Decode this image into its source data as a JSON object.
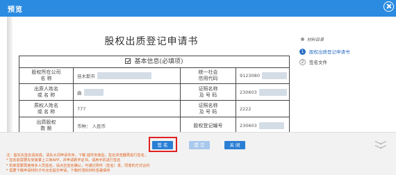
{
  "window": {
    "title": "预览"
  },
  "document": {
    "title": "股权出质登记申请书",
    "section_header": "基本信息(必填项)",
    "rows": [
      {
        "label1": "股权所在公司",
        "label1b": "名  称",
        "value1": "佳木斯市",
        "label2": "统一社会",
        "label2b": "信用代码",
        "value2": "9123080"
      },
      {
        "label1": "出质人姓名",
        "label1b": "或 名 称",
        "value1": "曲",
        "label2": "证照名称",
        "label2b": "及 号 码",
        "value2": "230603"
      },
      {
        "label1": "质权人姓名",
        "label1b": "或 名 称",
        "value1": "777",
        "label2": "证照名称",
        "label2b": "及 号 码",
        "value2": "2222"
      },
      {
        "label1": "出质股权",
        "label1b": "数  额",
        "value1": "币种： 人民币",
        "label2": "股权登记编号",
        "label2b": "",
        "value2": "230603"
      }
    ]
  },
  "outline": {
    "title": "材料目录",
    "items": [
      {
        "num": "1",
        "label": "股权出质登记申请书",
        "active": true
      },
      {
        "num": "2",
        "label": "签名文件",
        "active": false
      }
    ]
  },
  "footer": {
    "buttons": {
      "sign": "签 名",
      "submit": "提 交",
      "close": "关 闭"
    },
    "notes": [
      "注：首先先签名请完成，请先大词申请件序，下载 插件安装后，签名浏览器再进行签名；",
      "* 签名前需要先安装掌上工商APP，并申请数字证书，请用手机进行签名",
      "* 机率需要再使用多人员签名，请点击签名确认，可通过附件（签名）发，同意的方式合约",
      "* 需要下载申请材料才可点击提交申请，下载时须的材料签署保存"
    ]
  },
  "colors": {
    "titlebar": "#2a8be0",
    "primary_button": "#2a7fd4",
    "disabled_button": "#a8c8ec",
    "highlight": "#e02020",
    "notes_text": "#e0601a"
  }
}
